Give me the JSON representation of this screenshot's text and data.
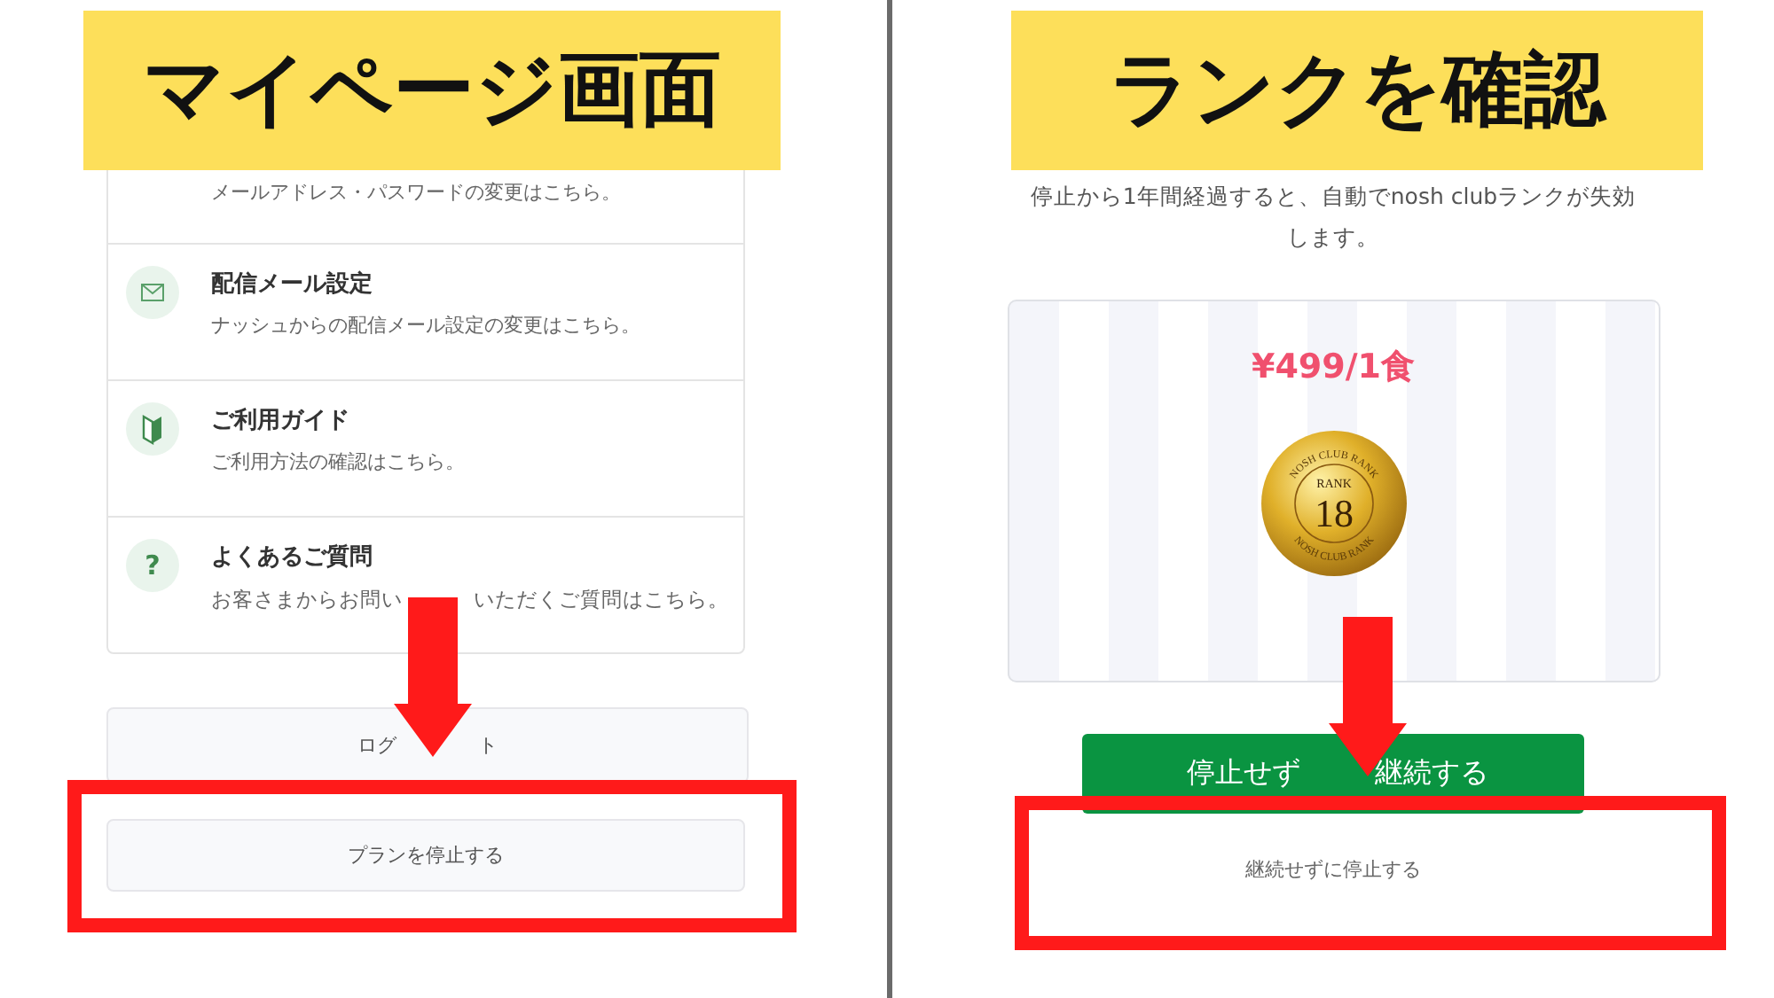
{
  "left_panel": {
    "banner": "マイページ画面",
    "menu_items": [
      {
        "kind": "none",
        "description": "メールアドレス・パスワードの変更はこちら。"
      },
      {
        "kind": "mail",
        "title": "配信メール設定",
        "description": "ナッシュからの配信メール設定の変更はこちら。"
      },
      {
        "kind": "guide",
        "title": "ご利用ガイド",
        "description": "ご利用方法の確認はこちら。"
      },
      {
        "kind": "faq",
        "icon_text": "?",
        "title": "よくあるご質問",
        "description_parts": [
          "お客さまからお問い",
          "いただくご質問はこちら。"
        ]
      }
    ],
    "logout_button_parts": [
      "ログ",
      "ト"
    ],
    "stop_plan_button": "プランを停止する"
  },
  "right_panel": {
    "banner": "ランクを確認",
    "notice": "停止から1年間経過すると、自動でnosh clubランクが失効します。",
    "rank_card": {
      "price": "¥499/1食",
      "badge": {
        "ring_text_top": "NOSH CLUB RANK",
        "ring_text_bottom": "NOSH CLUB RANK",
        "label": "RANK",
        "number": "18"
      }
    },
    "continue_button_parts": [
      "停止せず",
      "継続する"
    ],
    "stop_link": "継続せずに停止する"
  }
}
